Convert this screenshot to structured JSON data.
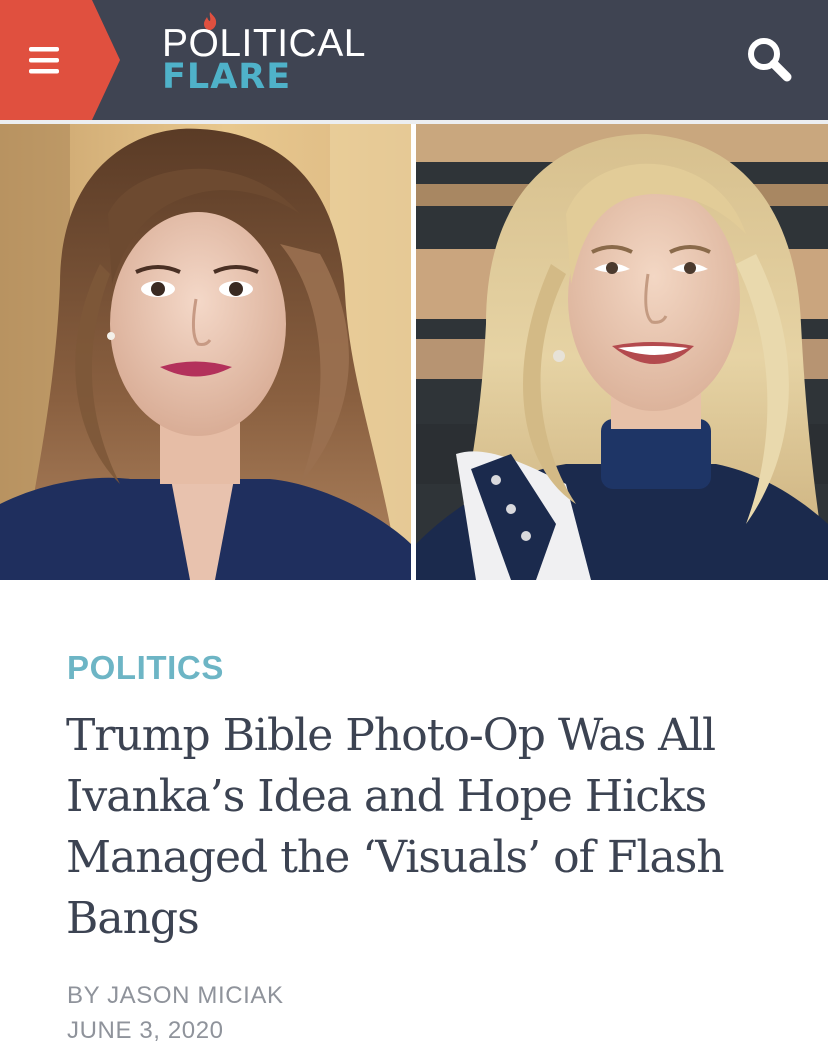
{
  "header": {
    "logo_top": "POLITICAL",
    "logo_bottom": "FLARE",
    "colors": {
      "background": "#3f4452",
      "menu_tab": "#e0503f",
      "logo_accent": "#4fb2c9",
      "flame": "#e0503f"
    },
    "menu_icon": "hamburger-icon",
    "search_icon": "search-icon"
  },
  "hero": {
    "left_photo": "portrait-photo",
    "right_photo": "portrait-photo"
  },
  "article": {
    "category": "POLITICS",
    "headline": "Trump Bible Photo-Op Was All Ivanka’s Idea and Hope Hicks Managed the ‘Visuals’ of Flash Bangs",
    "byline_prefix": "BY",
    "author": "JASON MICIAK",
    "date": "JUNE 3, 2020",
    "colors": {
      "category": "#6db5c5",
      "headline": "#3c4352",
      "meta": "#8f939b"
    }
  }
}
